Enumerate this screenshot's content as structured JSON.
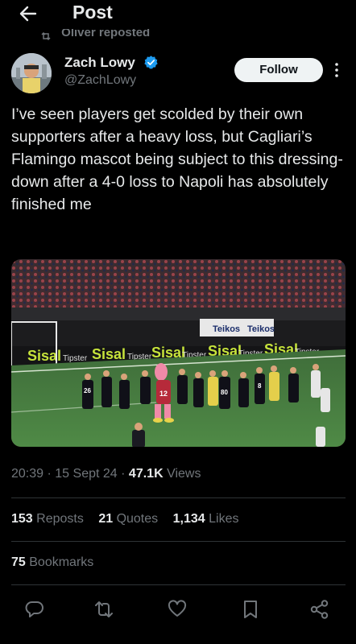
{
  "header": {
    "title": "Post"
  },
  "repost": {
    "text": "Oliver reposted"
  },
  "author": {
    "name": "Zach Lowy",
    "handle": "@ZachLowy",
    "verified": true
  },
  "follow": {
    "label": "Follow"
  },
  "tweet": {
    "text": "I’ve seen players get scolded by their own supporters after a heavy loss, but Cagliari’s Flamingo mascot being subject to this dressing-down after a 4-0 loss to Napoli has absolutely finished me"
  },
  "media": {
    "description_labels": {
      "board_brand_1": "Sisal",
      "board_sub_1": "Tipster",
      "board_brand_2": "Teikos",
      "player_number_1": "26",
      "player_number_2": "12",
      "player_number_3": "80",
      "player_number_4": "8"
    }
  },
  "meta": {
    "time": "20:39",
    "date": "15 Sept 24",
    "views_count": "47.1K",
    "views_label": "Views"
  },
  "stats": {
    "reposts_count": "153",
    "reposts_label": "Reposts",
    "quotes_count": "21",
    "quotes_label": "Quotes",
    "likes_count": "1,134",
    "likes_label": "Likes",
    "bookmarks_count": "75",
    "bookmarks_label": "Bookmarks"
  },
  "actions": [
    "reply-icon",
    "retweet-icon",
    "like-icon",
    "bookmark-icon",
    "share-icon"
  ],
  "colors": {
    "accent": "#1d9bf0",
    "text": "#e7e9ea",
    "muted": "#71767b",
    "divider": "#2f3336"
  }
}
